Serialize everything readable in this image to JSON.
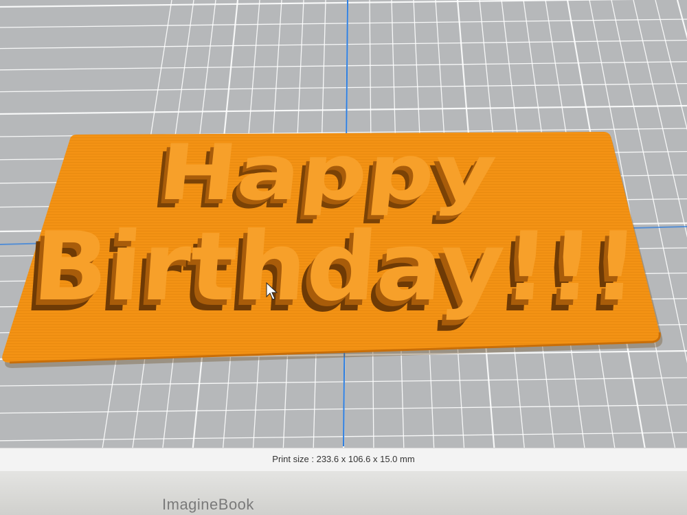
{
  "viewport": {
    "plate_color": "#f39214",
    "grid_color": "#ffffff",
    "bed_color": "#b6b8ba",
    "axis_color": "#2b7de0",
    "model_text": {
      "line1": "Happy",
      "line2": "Birthday!!!"
    },
    "cursor_icon": "arrow-cursor-icon"
  },
  "status_bar": {
    "print_size": "Print size : 233.6 x 106.6 x 15.0 mm"
  },
  "device": {
    "brand": "ImagineBook"
  }
}
